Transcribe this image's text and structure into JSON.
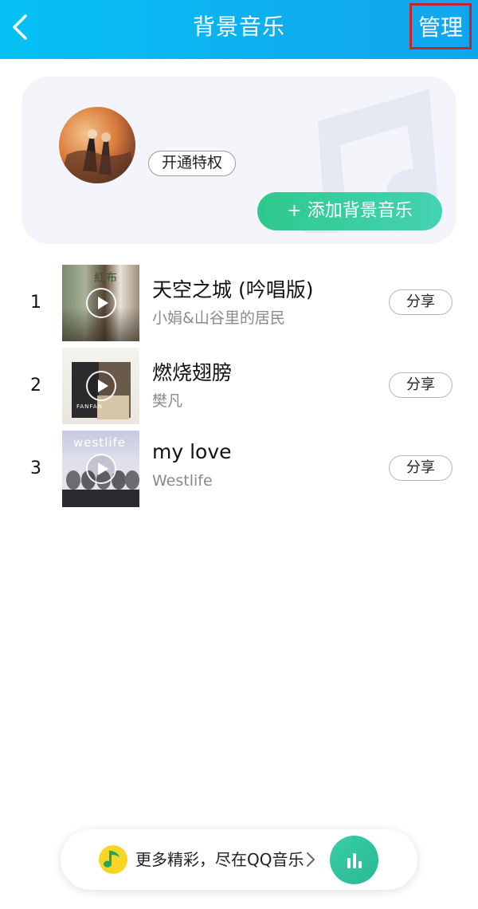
{
  "header": {
    "title": "背景音乐",
    "manage_label": "管理"
  },
  "card": {
    "privilege_label": "开通特权",
    "add_music_label": "+ 添加背景音乐"
  },
  "songs": [
    {
      "index": "1",
      "title": "天空之城 (吟唱版)",
      "artist": "小娟&山谷里的居民",
      "share_label": "分享"
    },
    {
      "index": "2",
      "title": "燃烧翅膀",
      "artist": "樊凡",
      "share_label": "分享"
    },
    {
      "index": "3",
      "title": "my love",
      "artist": "Westlife",
      "share_label": "分享"
    }
  ],
  "covers": {
    "cover_1_text": "紅布",
    "cover_2_text": "FANFAN",
    "cover_3_text": "westlife"
  },
  "promo": {
    "text": "更多精彩，尽在QQ音乐"
  },
  "colors": {
    "header_accent": "#0eaeee",
    "manage_highlight_border": "#c8232b",
    "add_button_green": "#2ec98d",
    "play_button_green": "#38cfa8"
  },
  "icons": {
    "back": "back-chevron-icon",
    "music_note": "music-note-icon",
    "play": "play-icon",
    "qq_music_logo": "qq-music-logo-icon",
    "chevron_right": "chevron-right-icon",
    "bars": "equalizer-bars-icon"
  }
}
